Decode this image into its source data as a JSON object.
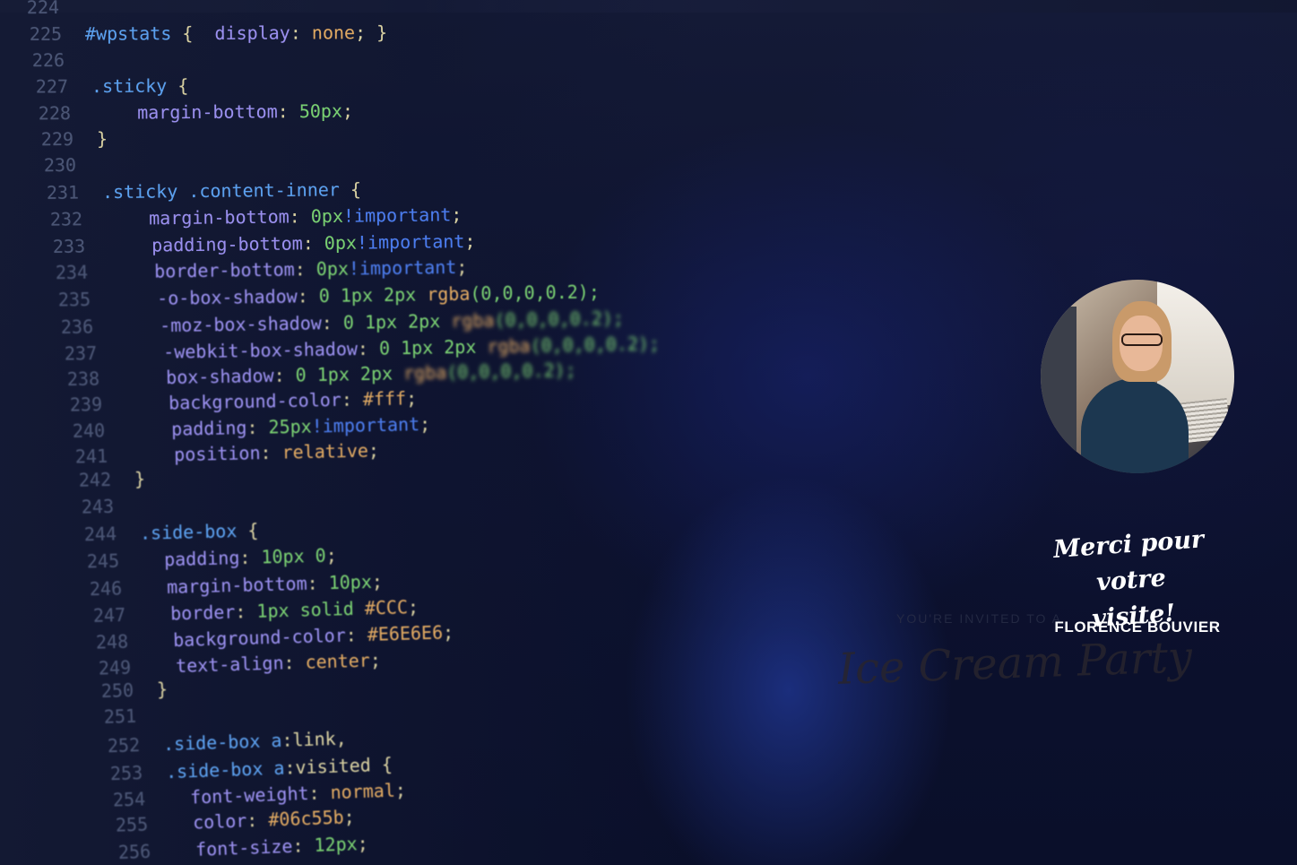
{
  "code_lines": [
    {
      "num": "224",
      "parts": []
    },
    {
      "num": "225",
      "parts": [
        {
          "t": "#wpstats ",
          "c": "sel"
        },
        {
          "t": "{  ",
          "c": "pun"
        },
        {
          "t": "display",
          "c": "prop"
        },
        {
          "t": ": ",
          "c": "pun"
        },
        {
          "t": "none",
          "c": "str"
        },
        {
          "t": "; }",
          "c": "pun"
        }
      ]
    },
    {
      "num": "226",
      "parts": []
    },
    {
      "num": "227",
      "parts": [
        {
          "t": ".sticky ",
          "c": "sel"
        },
        {
          "t": "{",
          "c": "pun"
        }
      ]
    },
    {
      "num": "228",
      "parts": [
        {
          "t": "    margin-bottom",
          "c": "prop"
        },
        {
          "t": ": ",
          "c": "pun"
        },
        {
          "t": "50px",
          "c": "val"
        },
        {
          "t": ";",
          "c": "pun"
        }
      ]
    },
    {
      "num": "229",
      "parts": [
        {
          "t": "}",
          "c": "pun"
        }
      ]
    },
    {
      "num": "230",
      "parts": []
    },
    {
      "num": "231",
      "parts": [
        {
          "t": ".sticky .content-inner ",
          "c": "sel"
        },
        {
          "t": "{",
          "c": "pun"
        }
      ]
    },
    {
      "num": "232",
      "parts": [
        {
          "t": "    margin-bottom",
          "c": "prop"
        },
        {
          "t": ": ",
          "c": "pun"
        },
        {
          "t": "0px",
          "c": "val"
        },
        {
          "t": "!important",
          "c": "imp"
        },
        {
          "t": ";",
          "c": "pun"
        }
      ]
    },
    {
      "num": "233",
      "parts": [
        {
          "t": "    padding-bottom",
          "c": "prop"
        },
        {
          "t": ": ",
          "c": "pun"
        },
        {
          "t": "0px",
          "c": "val"
        },
        {
          "t": "!important",
          "c": "imp"
        },
        {
          "t": ";",
          "c": "pun"
        }
      ]
    },
    {
      "num": "234",
      "parts": [
        {
          "t": "    border-bottom",
          "c": "prop"
        },
        {
          "t": ": ",
          "c": "pun"
        },
        {
          "t": "0px",
          "c": "val"
        },
        {
          "t": "!important",
          "c": "imp"
        },
        {
          "t": ";",
          "c": "pun"
        }
      ]
    },
    {
      "num": "235",
      "parts": [
        {
          "t": "    -o-box-shadow",
          "c": "prop"
        },
        {
          "t": ": ",
          "c": "pun"
        },
        {
          "t": "0 1px 2px ",
          "c": "val"
        },
        {
          "t": "rgba",
          "c": "str"
        },
        {
          "t": "(0,0,0,0.2);",
          "c": "val"
        }
      ]
    },
    {
      "num": "236",
      "parts": [
        {
          "t": "    -moz-box-shadow",
          "c": "prop"
        },
        {
          "t": ": ",
          "c": "pun"
        },
        {
          "t": "0 1px 2px ",
          "c": "val"
        },
        {
          "t": "rgba",
          "c": "str"
        },
        {
          "t": "(0,0,0,0.2);",
          "c": "val"
        }
      ]
    },
    {
      "num": "237",
      "parts": [
        {
          "t": "    -webkit-box-shadow",
          "c": "prop"
        },
        {
          "t": ": ",
          "c": "pun"
        },
        {
          "t": "0 1px 2px ",
          "c": "val"
        },
        {
          "t": "rgba",
          "c": "str"
        },
        {
          "t": "(0,0,0,0.2);",
          "c": "val"
        }
      ]
    },
    {
      "num": "238",
      "parts": [
        {
          "t": "    box-shadow",
          "c": "prop"
        },
        {
          "t": ": ",
          "c": "pun"
        },
        {
          "t": "0 1px 2px ",
          "c": "val"
        },
        {
          "t": "rgba",
          "c": "str"
        },
        {
          "t": "(0,0,0,0.2);",
          "c": "val"
        }
      ]
    },
    {
      "num": "239",
      "parts": [
        {
          "t": "    background-color",
          "c": "prop"
        },
        {
          "t": ": ",
          "c": "pun"
        },
        {
          "t": "#fff",
          "c": "str"
        },
        {
          "t": ";",
          "c": "pun"
        }
      ]
    },
    {
      "num": "240",
      "parts": [
        {
          "t": "    padding",
          "c": "prop"
        },
        {
          "t": ": ",
          "c": "pun"
        },
        {
          "t": "25px",
          "c": "val"
        },
        {
          "t": "!important",
          "c": "imp"
        },
        {
          "t": ";",
          "c": "pun"
        }
      ]
    },
    {
      "num": "241",
      "parts": [
        {
          "t": "    position",
          "c": "prop"
        },
        {
          "t": ": ",
          "c": "pun"
        },
        {
          "t": "relative",
          "c": "str"
        },
        {
          "t": ";",
          "c": "pun"
        }
      ]
    },
    {
      "num": "242",
      "parts": [
        {
          "t": "}",
          "c": "pun"
        }
      ]
    },
    {
      "num": "243",
      "parts": []
    },
    {
      "num": "244",
      "parts": [
        {
          "t": ".side-box ",
          "c": "sel"
        },
        {
          "t": "{",
          "c": "pun"
        }
      ]
    },
    {
      "num": "245",
      "parts": [
        {
          "t": "  padding",
          "c": "prop"
        },
        {
          "t": ": ",
          "c": "pun"
        },
        {
          "t": "10px 0",
          "c": "val"
        },
        {
          "t": ";",
          "c": "pun"
        }
      ]
    },
    {
      "num": "246",
      "parts": [
        {
          "t": "  margin-bottom",
          "c": "prop"
        },
        {
          "t": ": ",
          "c": "pun"
        },
        {
          "t": "10px",
          "c": "val"
        },
        {
          "t": ";",
          "c": "pun"
        }
      ]
    },
    {
      "num": "247",
      "parts": [
        {
          "t": "  border",
          "c": "prop"
        },
        {
          "t": ": ",
          "c": "pun"
        },
        {
          "t": "1px solid ",
          "c": "val"
        },
        {
          "t": "#CCC",
          "c": "str"
        },
        {
          "t": ";",
          "c": "pun"
        }
      ]
    },
    {
      "num": "248",
      "parts": [
        {
          "t": "  background-color",
          "c": "prop"
        },
        {
          "t": ": ",
          "c": "pun"
        },
        {
          "t": "#E6E6E6",
          "c": "str"
        },
        {
          "t": ";",
          "c": "pun"
        }
      ]
    },
    {
      "num": "249",
      "parts": [
        {
          "t": "  text-align",
          "c": "prop"
        },
        {
          "t": ": ",
          "c": "pun"
        },
        {
          "t": "center",
          "c": "str"
        },
        {
          "t": ";",
          "c": "pun"
        }
      ]
    },
    {
      "num": "250",
      "parts": [
        {
          "t": "}",
          "c": "pun"
        }
      ]
    },
    {
      "num": "251",
      "parts": []
    },
    {
      "num": "252",
      "parts": [
        {
          "t": ".side-box a",
          "c": "sel"
        },
        {
          "t": ":link,",
          "c": "pun"
        }
      ]
    },
    {
      "num": "253",
      "parts": [
        {
          "t": ".side-box a",
          "c": "sel"
        },
        {
          "t": ":visited {",
          "c": "pun"
        }
      ]
    },
    {
      "num": "254",
      "parts": [
        {
          "t": "  font-weight",
          "c": "prop"
        },
        {
          "t": ": ",
          "c": "pun"
        },
        {
          "t": "normal",
          "c": "str"
        },
        {
          "t": ";",
          "c": "pun"
        }
      ]
    },
    {
      "num": "255",
      "parts": [
        {
          "t": "  color",
          "c": "prop"
        },
        {
          "t": ": ",
          "c": "pun"
        },
        {
          "t": "#06c55b",
          "c": "str"
        },
        {
          "t": ";",
          "c": "pun"
        }
      ]
    },
    {
      "num": "256",
      "parts": [
        {
          "t": "  font-size",
          "c": "prop"
        },
        {
          "t": ": ",
          "c": "pun"
        },
        {
          "t": "12px",
          "c": "val"
        },
        {
          "t": ";",
          "c": "pun"
        }
      ]
    }
  ],
  "card": {
    "thanks_line1": "Merci pour votre",
    "thanks_line2": "visite!",
    "name": "FLORENCE BOUVIER",
    "ghost_invite": "YOU'RE INVITED TO A",
    "ghost_title": "Ice Cream Party"
  },
  "avatar_icon": "portrait-photo"
}
